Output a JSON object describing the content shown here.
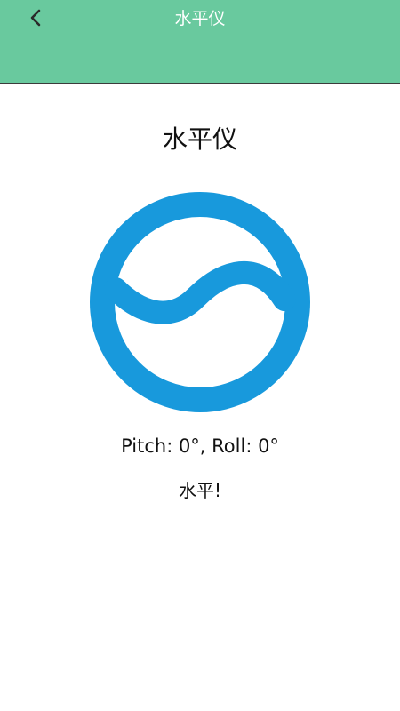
{
  "header": {
    "back_icon": "chevron-left-icon",
    "title": "水平仪"
  },
  "main": {
    "title": "水平仪",
    "level_icon": "level-wave-icon",
    "readout": "Pitch: 0°, Roll: 0°",
    "status": "水平!"
  },
  "colors": {
    "header_bg": "#69c99e",
    "accent": "#1899dc",
    "text": "#111111",
    "header_text": "#ffffff"
  }
}
